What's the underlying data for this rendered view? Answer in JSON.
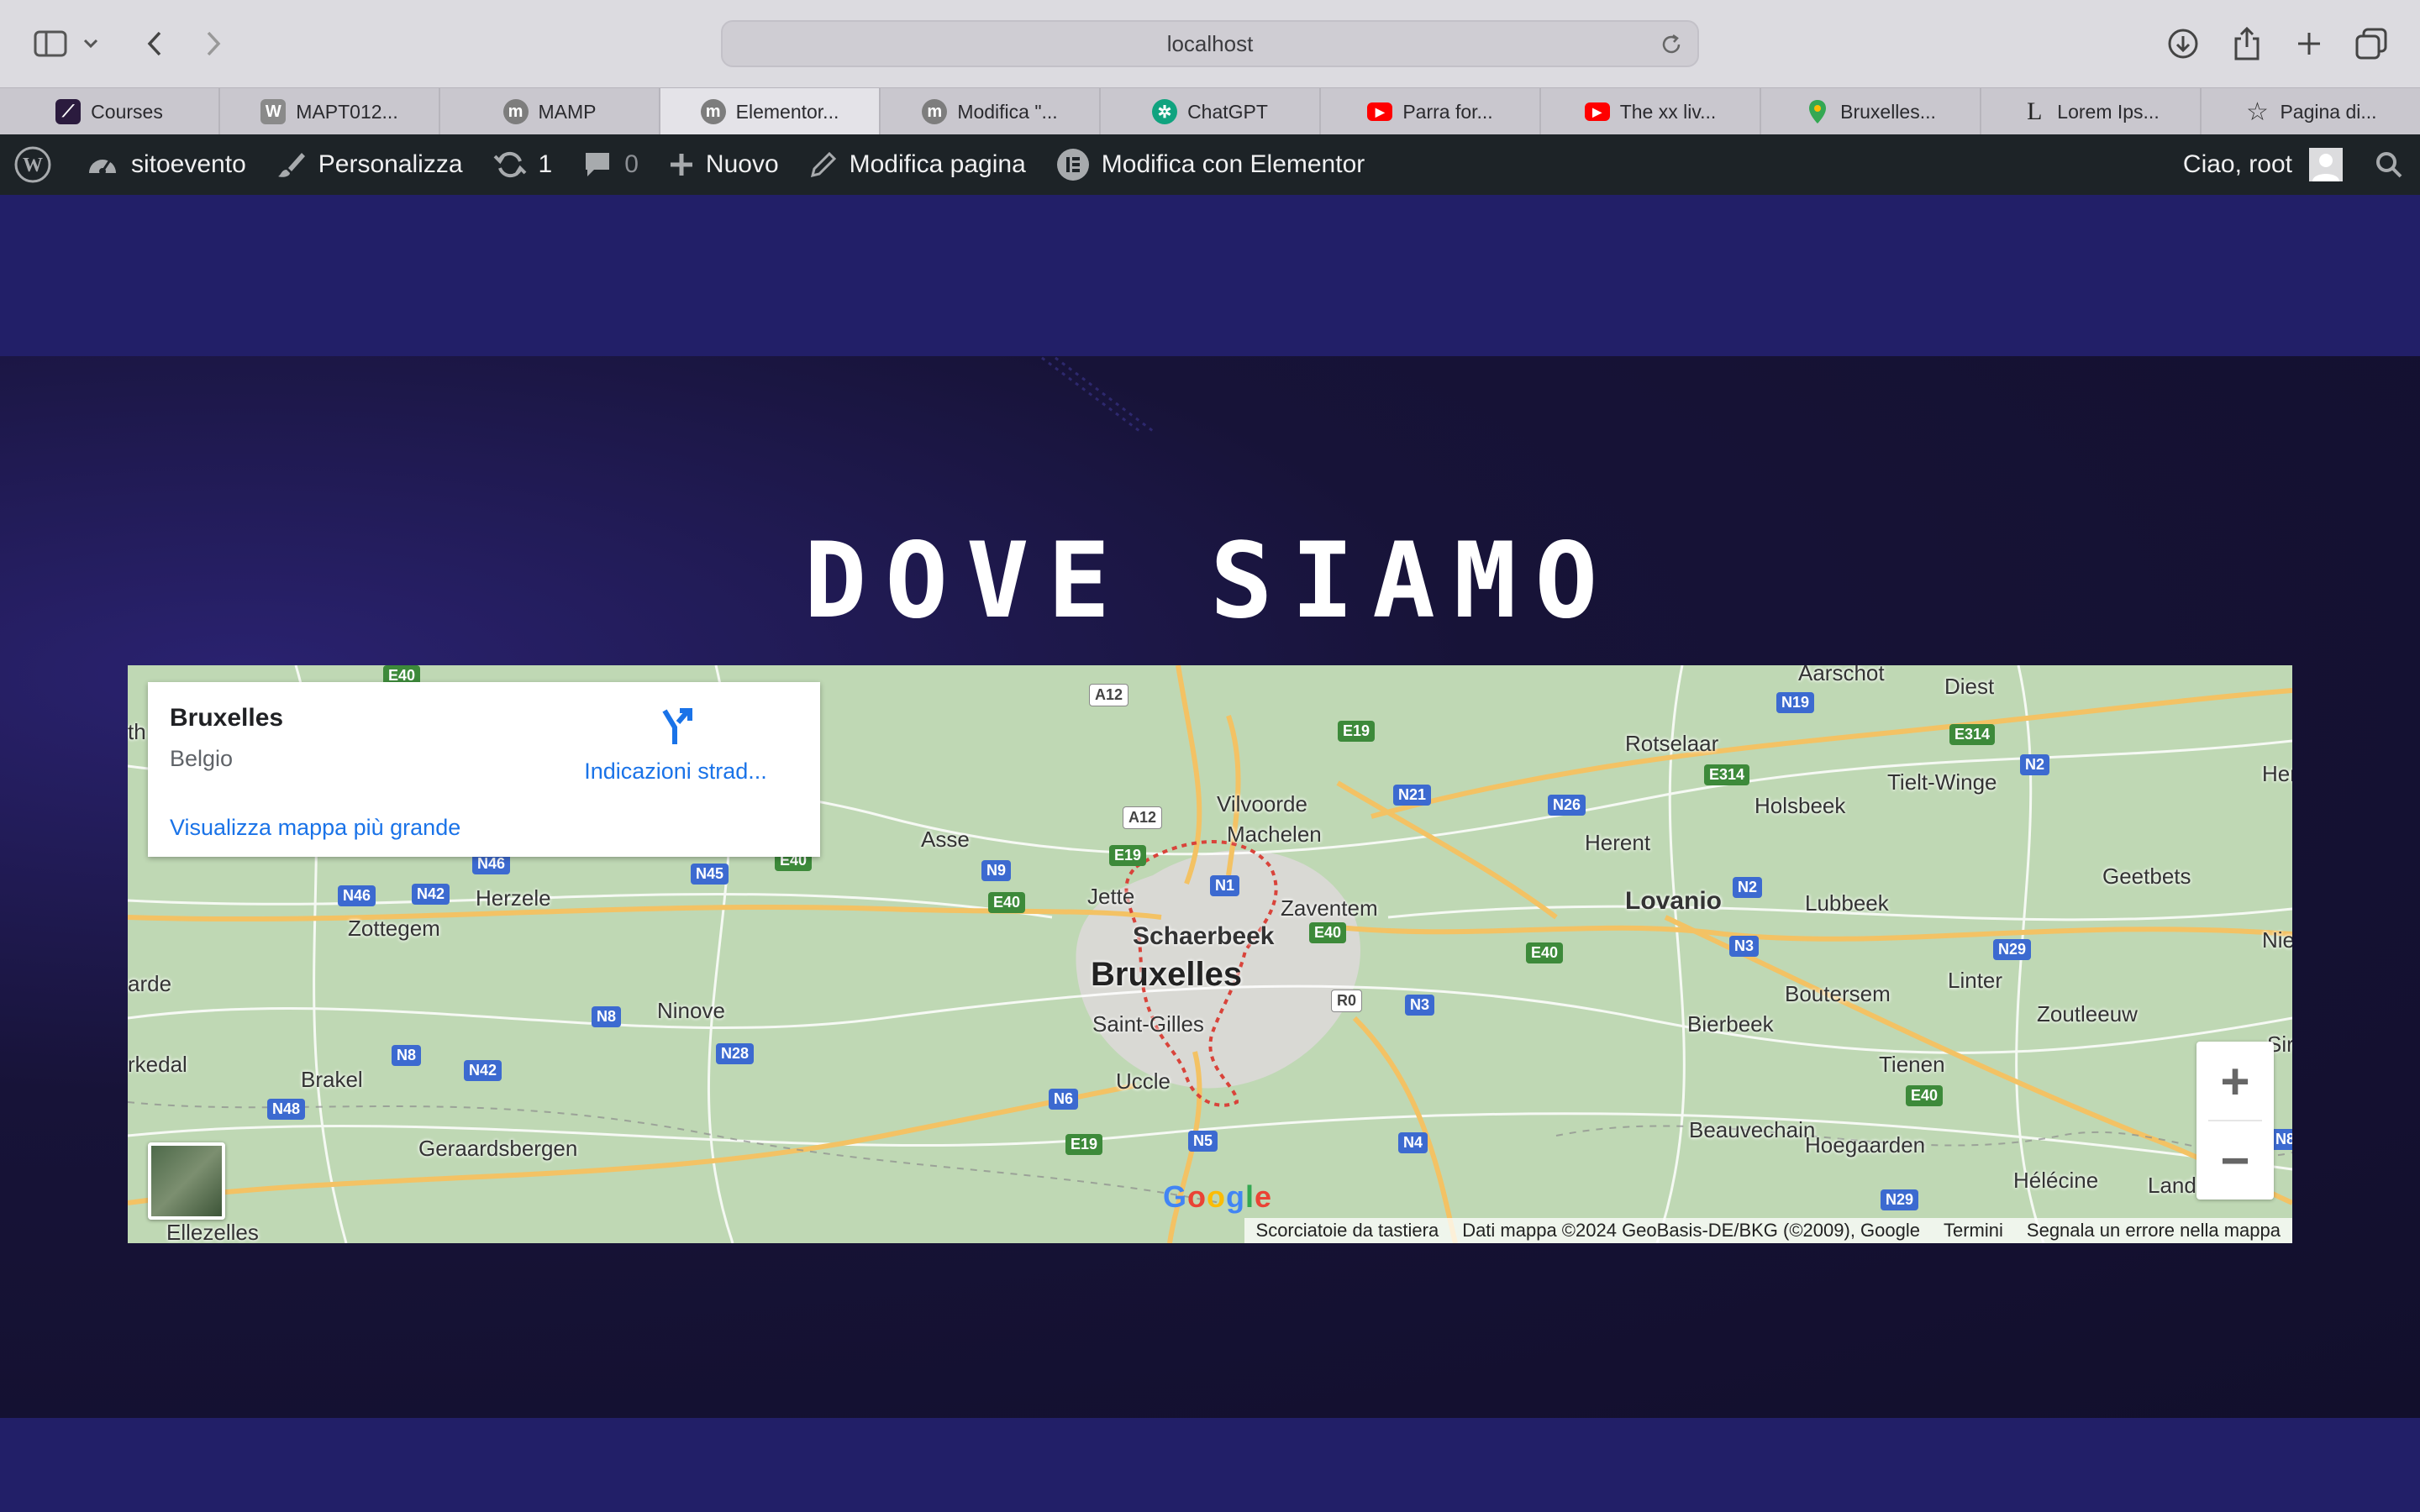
{
  "browser": {
    "url": "localhost",
    "tabs": [
      {
        "label": "Courses",
        "icon": "courses-icon",
        "color": "#2b1b3e"
      },
      {
        "label": "MAPT012...",
        "icon": "wikipedia-icon",
        "color": "#7d7d7d"
      },
      {
        "label": "MAMP",
        "icon": "mamp-icon",
        "color": "#7d7d7d"
      },
      {
        "label": "Elementor...",
        "icon": "mamp-icon",
        "color": "#7d7d7d"
      },
      {
        "label": "Modifica \"...",
        "icon": "mamp-icon",
        "color": "#7d7d7d"
      },
      {
        "label": "ChatGPT",
        "icon": "chatgpt-icon",
        "color": "#10a37f"
      },
      {
        "label": "Parra for...",
        "icon": "youtube-icon",
        "color": "#ff0000"
      },
      {
        "label": "The xx liv...",
        "icon": "youtube-icon",
        "color": "#ff0000"
      },
      {
        "label": "Bruxelles...",
        "icon": "google-maps-icon",
        "color": "#34a853"
      },
      {
        "label": "Lorem Ips...",
        "icon": "lorem-ipsum-icon",
        "color": "#ffffff"
      },
      {
        "label": "Pagina di...",
        "icon": "star-icon",
        "color": "#ffffff"
      }
    ],
    "active_tab": "Elementor..."
  },
  "adminbar": {
    "site": "sitoevento",
    "customize": "Personalizza",
    "updates": "1",
    "comments": "0",
    "new": "Nuovo",
    "edit_page": "Modifica pagina",
    "edit_elementor": "Modifica con Elementor",
    "greeting": "Ciao, root"
  },
  "section": {
    "title": "DOVE SIAMO"
  },
  "map": {
    "card_title": "Bruxelles",
    "card_subtitle": "Belgio",
    "directions": "Indicazioni strad...",
    "larger_map": "Visualizza mappa più grande",
    "zoom_in": "+",
    "zoom_out": "−",
    "google_logo": "Google",
    "attribution": {
      "shortcuts": "Scorciatoie da tastiera",
      "data": "Dati mappa ©2024 GeoBasis-DE/BKG (©2009), Google",
      "terms": "Termini",
      "report": "Segnala un errore nella mappa"
    },
    "places": {
      "bruxelles": "Bruxelles",
      "schaerbeek": "Schaerbeek",
      "saint_gilles": "Saint-Gilles",
      "uccle": "Uccle",
      "jette": "Jette",
      "vilvoorde": "Vilvoorde",
      "machelen": "Machelen",
      "zaventem": "Zaventem",
      "asse": "Asse",
      "herzele": "Herzele",
      "zottegem": "Zottegem",
      "ninove": "Ninove",
      "brakel": "Brakel",
      "geraardsbergen": "Geraardsbergen",
      "ellezelles": "Ellezelles",
      "rkedal": "rkedal",
      "arde": "arde",
      "th": "th",
      "rotselaar": "Rotselaar",
      "holsbeek": "Holsbeek",
      "tielt_winge": "Tielt-Winge",
      "herent": "Herent",
      "lovanio": "Lovanio",
      "lubbeek": "Lubbeek",
      "geetbets": "Geetbets",
      "boutersem": "Boutersem",
      "bierbeek": "Bierbeek",
      "linter": "Linter",
      "zoutleeuw": "Zoutleeuw",
      "tienen": "Tienen",
      "beauvechain": "Beauvechain",
      "hoegaarden": "Hoegaarden",
      "helecine": "Hélécine",
      "diest": "Diest",
      "aarschot": "Aarschot",
      "herk": "Herk",
      "nie": "Nie",
      "sir": "Sir",
      "land": "Land"
    },
    "shields": {
      "a12a": "A12",
      "a12b": "A12",
      "e19a": "E19",
      "e19b": "E19",
      "e19c": "E19",
      "n21": "N21",
      "n26": "N26",
      "n19": "N19",
      "e314a": "E314",
      "e314b": "E314",
      "n2a": "N2",
      "n2b": "N2",
      "n1": "N1",
      "e40a": "E40",
      "e40b": "E40",
      "e40c": "E40",
      "e40d": "E40",
      "e40e": "E40",
      "e40f": "E40",
      "n9": "N9",
      "n45": "N45",
      "n46a": "N46",
      "n46b": "N46",
      "n42a": "N42",
      "n42b": "N42",
      "n8a": "N8",
      "n8b": "N8",
      "n28": "N28",
      "n48": "N48",
      "n6": "N6",
      "n5": "N5",
      "n4": "N4",
      "n3a": "N3",
      "n3b": "N3",
      "r0": "R0",
      "n29a": "N29",
      "n29b": "N29",
      "n8c": "N8"
    }
  }
}
